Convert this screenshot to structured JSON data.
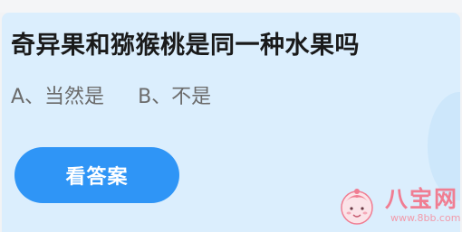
{
  "question": {
    "text": "奇异果和猕猴桃是同一种水果吗"
  },
  "options": [
    {
      "label": "A、当然是"
    },
    {
      "label": "B、不是"
    }
  ],
  "answer_button": {
    "label": "看答案"
  },
  "watermark": {
    "name": "八宝网",
    "url": "www.8bb.com"
  },
  "colors": {
    "card_background": "#dbeefd",
    "button": "#2f95f6",
    "watermark": "#f07d92"
  }
}
